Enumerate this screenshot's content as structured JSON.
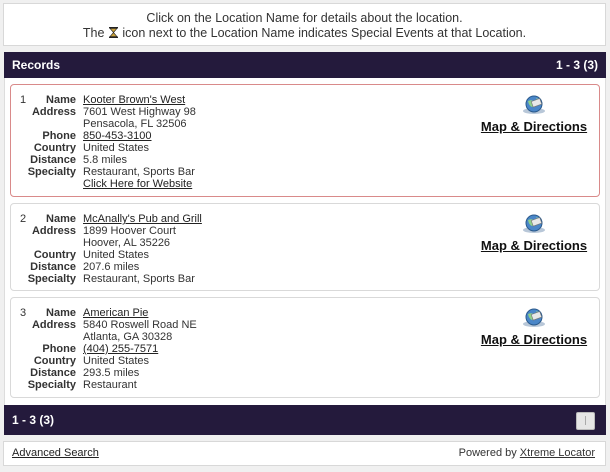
{
  "notice": {
    "line1": "Click on the Location Name for details about the location.",
    "line2_pre": "The",
    "line2_post": "icon next to the Location Name indicates Special Events at that Location.",
    "icon": "hourglass-icon"
  },
  "records_bar": {
    "title": "Records",
    "range": "1 - 3 (3)"
  },
  "labels": {
    "name": "Name",
    "address": "Address",
    "phone": "Phone",
    "country": "Country",
    "distance": "Distance",
    "specialty": "Specialty"
  },
  "map_link": "Map & Directions",
  "records": [
    {
      "num": "1",
      "name": "Kooter Brown's West",
      "address1": "7601 West Highway 98",
      "address2": "Pensacola, FL 32506",
      "phone": "850-453-3100",
      "country": "United States",
      "distance": "5.8 miles",
      "specialty": "Restaurant, Sports Bar",
      "website": "Click Here for Website"
    },
    {
      "num": "2",
      "name": "McAnally's Pub and Grill",
      "address1": "1899 Hoover Court",
      "address2": "Hoover, AL 35226",
      "country": "United States",
      "distance": "207.6 miles",
      "specialty": "Restaurant, Sports Bar"
    },
    {
      "num": "3",
      "name": "American Pie",
      "address1": "5840 Roswell Road NE",
      "address2": "Atlanta, GA 30328",
      "phone": "(404) 255-7571",
      "country": "United States",
      "distance": "293.5 miles",
      "specialty": "Restaurant"
    }
  ],
  "bottom_bar": {
    "range": "1 - 3 (3)"
  },
  "footer": {
    "advanced_search": "Advanced Search",
    "powered_by": "Powered by",
    "powered_link": "Xtreme Locator"
  },
  "colors": {
    "bar": "#241a3c",
    "highlight_border": "#d98a8a"
  }
}
